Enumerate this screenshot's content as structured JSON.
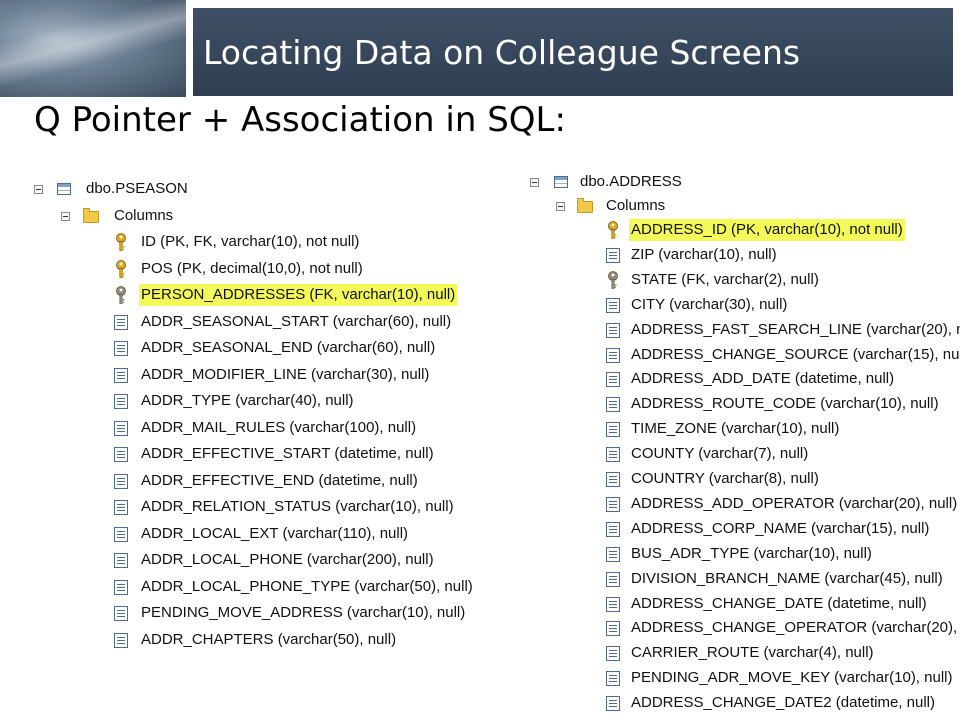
{
  "slide": {
    "title": "Locating Data on Colleague Screens",
    "subtitle": "Q Pointer + Association in SQL:"
  },
  "colors": {
    "title_bar": "#34445a",
    "highlight": "#f4f95a",
    "key_gold": "#e0a81a",
    "key_gray": "#8c8c8c"
  },
  "left_tree": {
    "table": "dbo.PSEASON",
    "folder": "Columns",
    "columns": [
      {
        "text": "ID (PK, FK, varchar(10), not null)",
        "icon": "key-gold-icon",
        "highlight": false
      },
      {
        "text": "POS (PK, decimal(10,0), not null)",
        "icon": "key-gold-icon",
        "highlight": false
      },
      {
        "text": "PERSON_ADDRESSES (FK, varchar(10), null)",
        "icon": "key-gray-icon",
        "highlight": true
      },
      {
        "text": "ADDR_SEASONAL_START (varchar(60), null)",
        "icon": "column-icon",
        "highlight": false
      },
      {
        "text": "ADDR_SEASONAL_END (varchar(60), null)",
        "icon": "column-icon",
        "highlight": false
      },
      {
        "text": "ADDR_MODIFIER_LINE (varchar(30), null)",
        "icon": "column-icon",
        "highlight": false
      },
      {
        "text": "ADDR_TYPE (varchar(40), null)",
        "icon": "column-icon",
        "highlight": false
      },
      {
        "text": "ADDR_MAIL_RULES (varchar(100), null)",
        "icon": "column-icon",
        "highlight": false
      },
      {
        "text": "ADDR_EFFECTIVE_START (datetime, null)",
        "icon": "column-icon",
        "highlight": false
      },
      {
        "text": "ADDR_EFFECTIVE_END (datetime, null)",
        "icon": "column-icon",
        "highlight": false
      },
      {
        "text": "ADDR_RELATION_STATUS (varchar(10), null)",
        "icon": "column-icon",
        "highlight": false
      },
      {
        "text": "ADDR_LOCAL_EXT (varchar(110), null)",
        "icon": "column-icon",
        "highlight": false
      },
      {
        "text": "ADDR_LOCAL_PHONE (varchar(200), null)",
        "icon": "column-icon",
        "highlight": false
      },
      {
        "text": "ADDR_LOCAL_PHONE_TYPE (varchar(50), null)",
        "icon": "column-icon",
        "highlight": false
      },
      {
        "text": "PENDING_MOVE_ADDRESS (varchar(10), null)",
        "icon": "column-icon",
        "highlight": false
      },
      {
        "text": "ADDR_CHAPTERS (varchar(50), null)",
        "icon": "column-icon",
        "highlight": false
      }
    ]
  },
  "right_tree": {
    "table": "dbo.ADDRESS",
    "folder": "Columns",
    "columns": [
      {
        "text": "ADDRESS_ID (PK, varchar(10), not null)",
        "icon": "key-gold-icon",
        "highlight": true
      },
      {
        "text": "ZIP (varchar(10), null)",
        "icon": "column-icon",
        "highlight": false
      },
      {
        "text": "STATE (FK, varchar(2), null)",
        "icon": "key-gray-icon",
        "highlight": false
      },
      {
        "text": "CITY (varchar(30), null)",
        "icon": "column-icon",
        "highlight": false
      },
      {
        "text": "ADDRESS_FAST_SEARCH_LINE (varchar(20), n",
        "icon": "column-icon",
        "highlight": false
      },
      {
        "text": "ADDRESS_CHANGE_SOURCE (varchar(15), nu",
        "icon": "column-icon",
        "highlight": false
      },
      {
        "text": "ADDRESS_ADD_DATE (datetime, null)",
        "icon": "column-icon",
        "highlight": false
      },
      {
        "text": "ADDRESS_ROUTE_CODE (varchar(10), null)",
        "icon": "column-icon",
        "highlight": false
      },
      {
        "text": "TIME_ZONE (varchar(10), null)",
        "icon": "column-icon",
        "highlight": false
      },
      {
        "text": "COUNTY (varchar(7), null)",
        "icon": "column-icon",
        "highlight": false
      },
      {
        "text": "COUNTRY (varchar(8), null)",
        "icon": "column-icon",
        "highlight": false
      },
      {
        "text": "ADDRESS_ADD_OPERATOR (varchar(20), null)",
        "icon": "column-icon",
        "highlight": false
      },
      {
        "text": "ADDRESS_CORP_NAME (varchar(15), null)",
        "icon": "column-icon",
        "highlight": false
      },
      {
        "text": "BUS_ADR_TYPE (varchar(10), null)",
        "icon": "column-icon",
        "highlight": false
      },
      {
        "text": "DIVISION_BRANCH_NAME (varchar(45), null)",
        "icon": "column-icon",
        "highlight": false
      },
      {
        "text": "ADDRESS_CHANGE_DATE (datetime, null)",
        "icon": "column-icon",
        "highlight": false
      },
      {
        "text": "ADDRESS_CHANGE_OPERATOR (varchar(20),",
        "icon": "column-icon",
        "highlight": false
      },
      {
        "text": "CARRIER_ROUTE (varchar(4), null)",
        "icon": "column-icon",
        "highlight": false
      },
      {
        "text": "PENDING_ADR_MOVE_KEY (varchar(10), null)",
        "icon": "column-icon",
        "highlight": false
      },
      {
        "text": "ADDRESS_CHANGE_DATE2 (datetime, null)",
        "icon": "column-icon",
        "highlight": false
      }
    ]
  }
}
